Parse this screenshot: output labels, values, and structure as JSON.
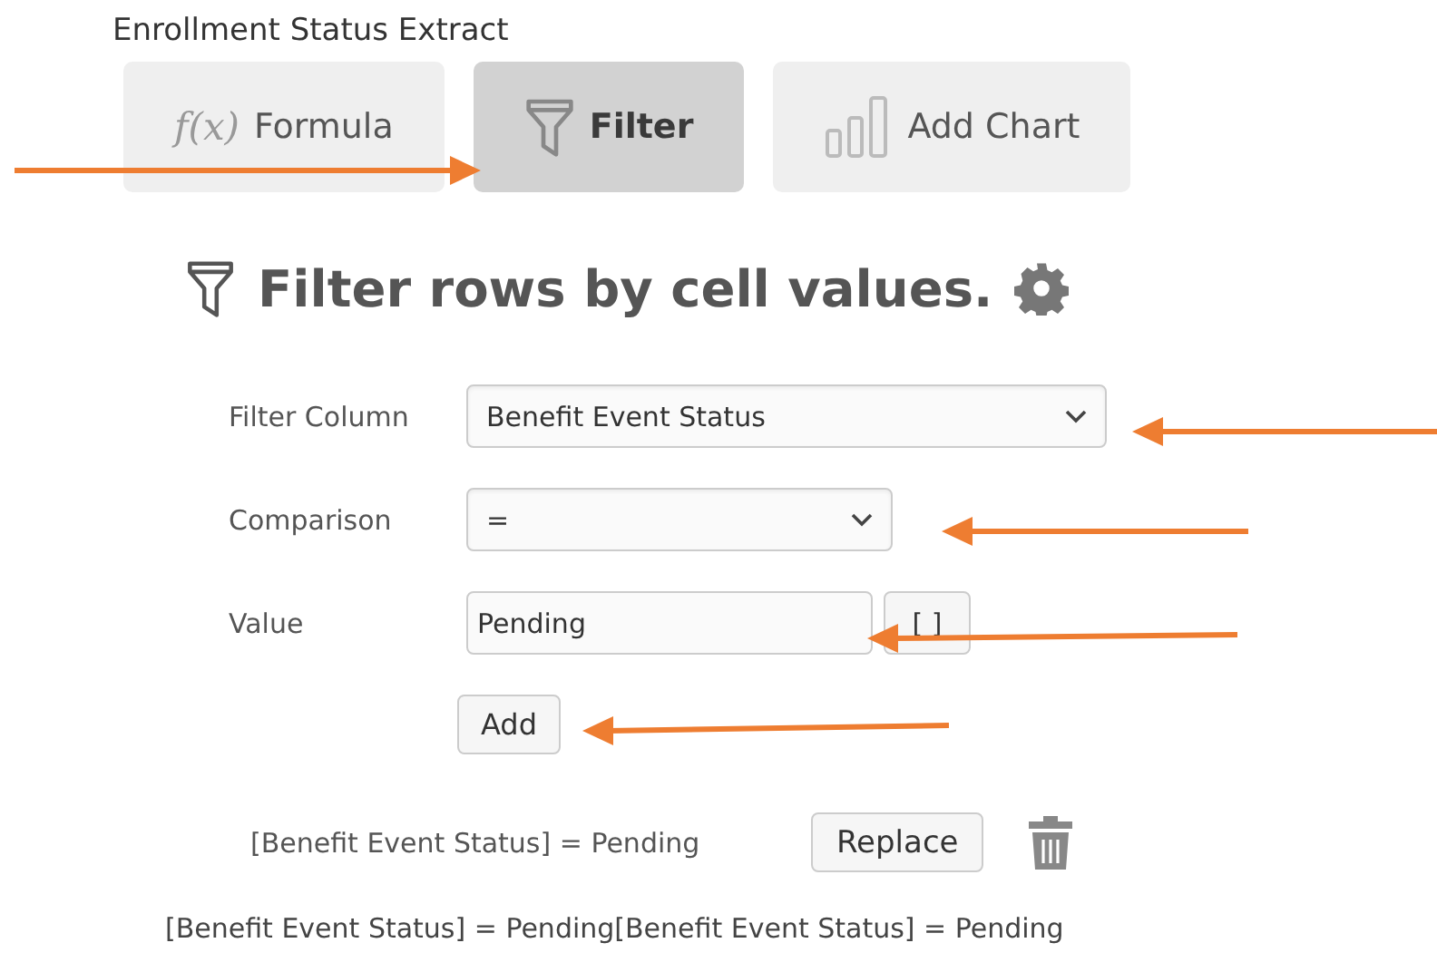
{
  "title": "Enrollment Status Extract",
  "tabs": [
    {
      "kind": "formula",
      "icon_text": "f(x)",
      "label": "Formula",
      "selected": false
    },
    {
      "kind": "filter",
      "label": "Filter",
      "selected": true
    },
    {
      "kind": "chart",
      "label": "Add Chart",
      "selected": false
    }
  ],
  "heading": "Filter rows by cell values.",
  "form": {
    "filter_column": {
      "label": "Filter Column",
      "value": "Benefit Event Status"
    },
    "comparison": {
      "label": "Comparison",
      "value": "="
    },
    "value": {
      "label": "Value",
      "value": "Pending",
      "bracket_button": "[ ]"
    },
    "add_button": "Add"
  },
  "conditions": [
    {
      "text": "[Benefit Event Status] = Pending",
      "replace_button": "Replace"
    }
  ],
  "summary": "[Benefit Event Status] = Pending[Benefit Event Status] = Pending"
}
